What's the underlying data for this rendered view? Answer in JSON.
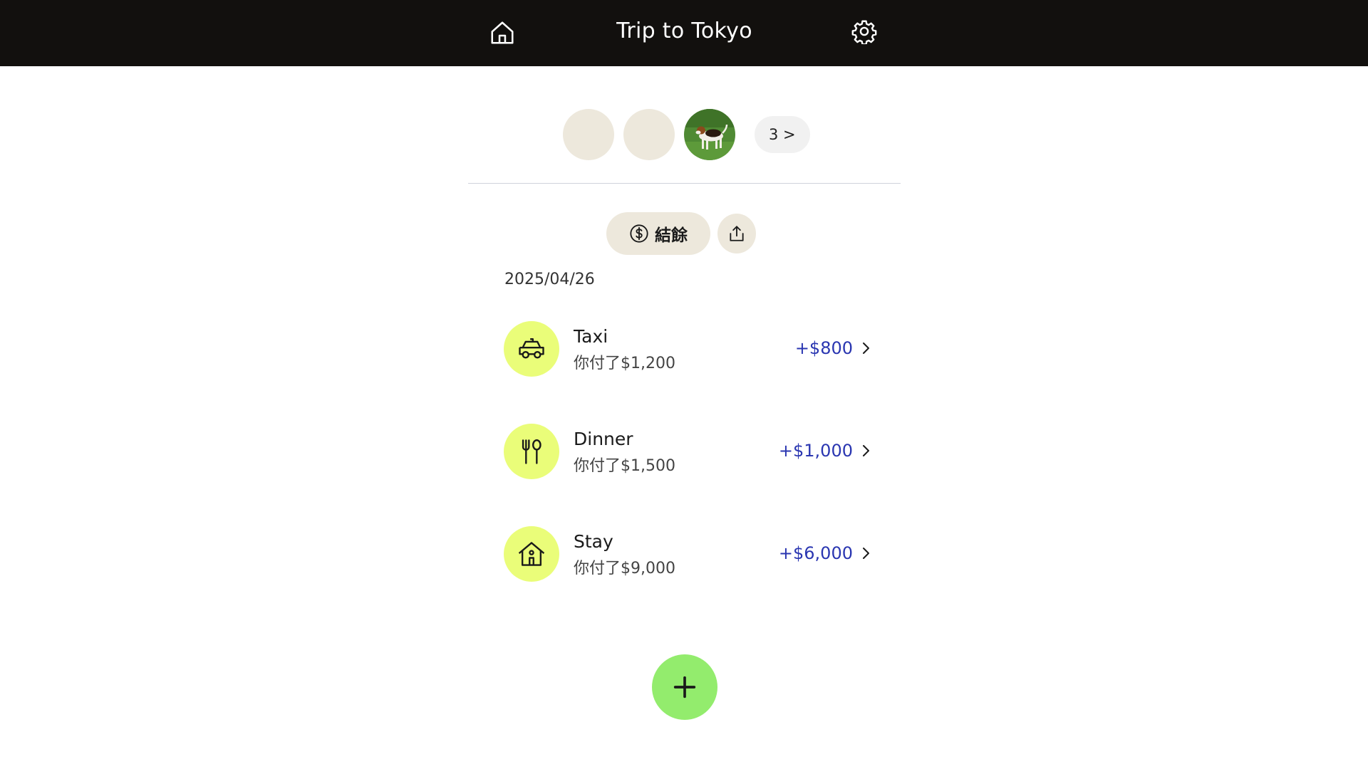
{
  "header": {
    "title": "Trip to Tokyo",
    "home_icon": "home-icon",
    "settings_icon": "gear-icon",
    "background": "#12100e"
  },
  "members": {
    "avatars": [
      "avatar-placeholder",
      "avatar-placeholder",
      "avatar-photo-dog"
    ],
    "count_label": "3 >"
  },
  "actions": {
    "settle_label": "結餘",
    "settle_icon": "dollar-circle-icon",
    "share_icon": "share-icon"
  },
  "date_group": "2025/04/26",
  "expenses": [
    {
      "name": "Taxi",
      "paid": "你付了$1,200",
      "amount": "+$800",
      "icon": "taxi-icon"
    },
    {
      "name": "Dinner",
      "paid": "你付了$1,500",
      "amount": "+$1,000",
      "icon": "utensils-icon"
    },
    {
      "name": "Stay",
      "paid": "你付了$9,000",
      "amount": "+$6,000",
      "icon": "house-icon"
    }
  ],
  "fab": {
    "icon": "plus-icon"
  },
  "colors": {
    "accent_icon_bg": "#eafd79",
    "fab": "#93ec6d",
    "amount": "#2a36b1",
    "pill": "#ede8dc"
  }
}
